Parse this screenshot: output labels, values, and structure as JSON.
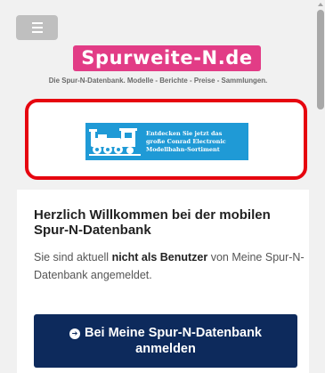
{
  "header": {
    "menu_icon": "hamburger-icon",
    "logo_text": "Spurweite-N.de",
    "tagline": "Die Spur-N-Datenbank. Modelle - Berichte - Preise - Sammlungen."
  },
  "ad": {
    "icon": "locomotive-icon",
    "line1": "Entdecken Sie jetzt das",
    "line2": "große Conrad Electronic",
    "line3": "Modellbahn-Sortiment"
  },
  "welcome": {
    "title": "Herzlich Willkommen bei der mobilen Spur-N-Datenbank",
    "notice_prefix": "Sie sind aktuell ",
    "notice_bold": "nicht als Benutzer",
    "notice_suffix": " von Meine Spur-N-Datenbank angemeldet.",
    "login_icon": "arrow-circle-right-icon",
    "login_glyph": "➔",
    "login_label": "Bei Meine Spur-N-Datenbank anmelden"
  },
  "colors": {
    "logo_bg": "#e23c86",
    "ad_border": "#e6050f",
    "ad_bg": "#1f9ad6",
    "button_bg": "#0d2a5c"
  }
}
